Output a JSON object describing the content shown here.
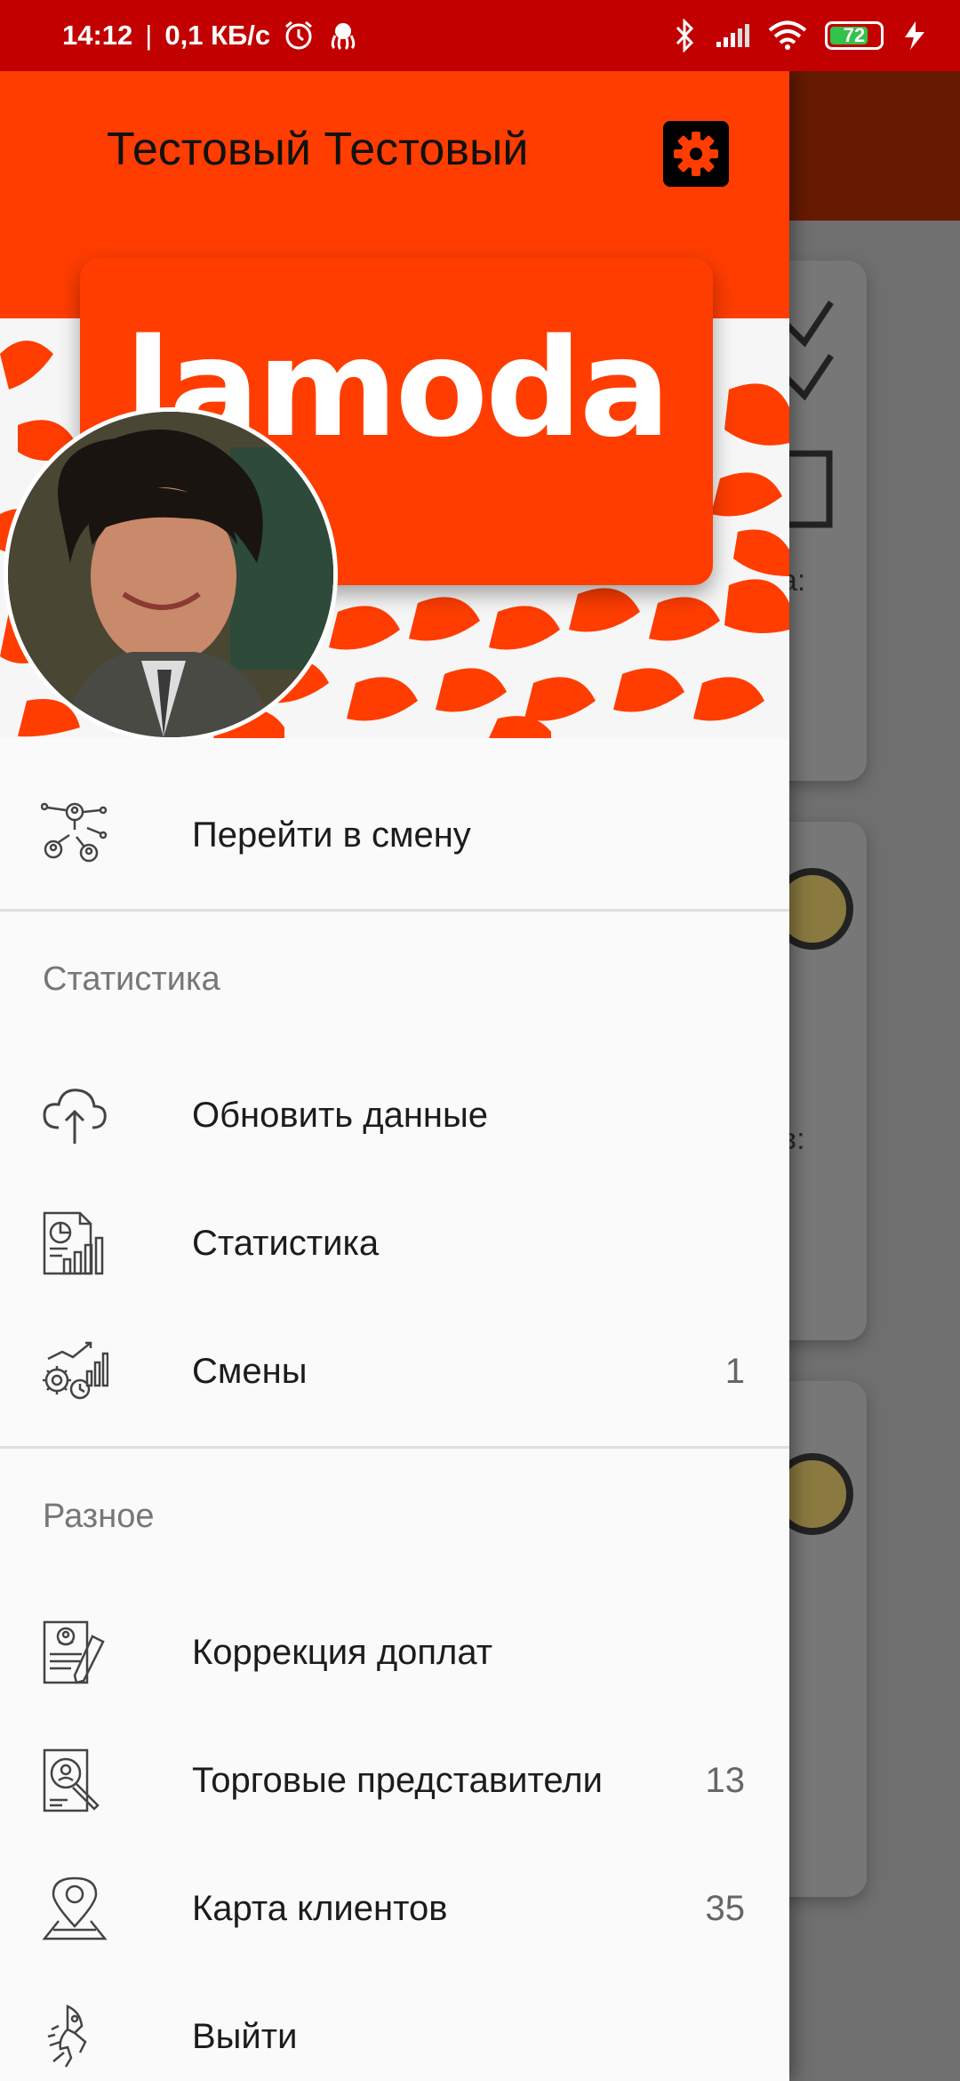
{
  "status_bar": {
    "time": "14:12",
    "separator": "|",
    "net_speed": "0,1 КБ/с",
    "battery": "72"
  },
  "drawer": {
    "user_name": "Тестовый Тестовый",
    "brand": "lamoda",
    "menu": {
      "go_to_shift": {
        "label": "Перейти в смену",
        "icon": "network-users-icon"
      },
      "section_stats": "Статистика",
      "refresh": {
        "label": "Обновить данные",
        "icon": "cloud-upload-icon"
      },
      "stats": {
        "label": "Статистика",
        "icon": "report-chart-icon"
      },
      "shifts": {
        "label": "Смены",
        "count": "1",
        "icon": "gears-chart-icon"
      },
      "section_misc": "Разное",
      "bonus_correction": {
        "label": "Коррекция доплат",
        "icon": "profile-edit-icon"
      },
      "sales_reps": {
        "label": "Торговые представители",
        "count": "13",
        "icon": "profile-search-icon"
      },
      "client_map": {
        "label": "Карта клиентов",
        "count": "35",
        "icon": "map-pin-icon"
      },
      "logout": {
        "label": "Выйти",
        "icon": "rocket-runner-icon"
      }
    }
  },
  "background": {
    "fragment1": "а:",
    "fragment2": "в:"
  },
  "colors": {
    "status_bar": "#c20000",
    "header": "#ff3d00",
    "scrim_toolbar": "#661a00"
  }
}
